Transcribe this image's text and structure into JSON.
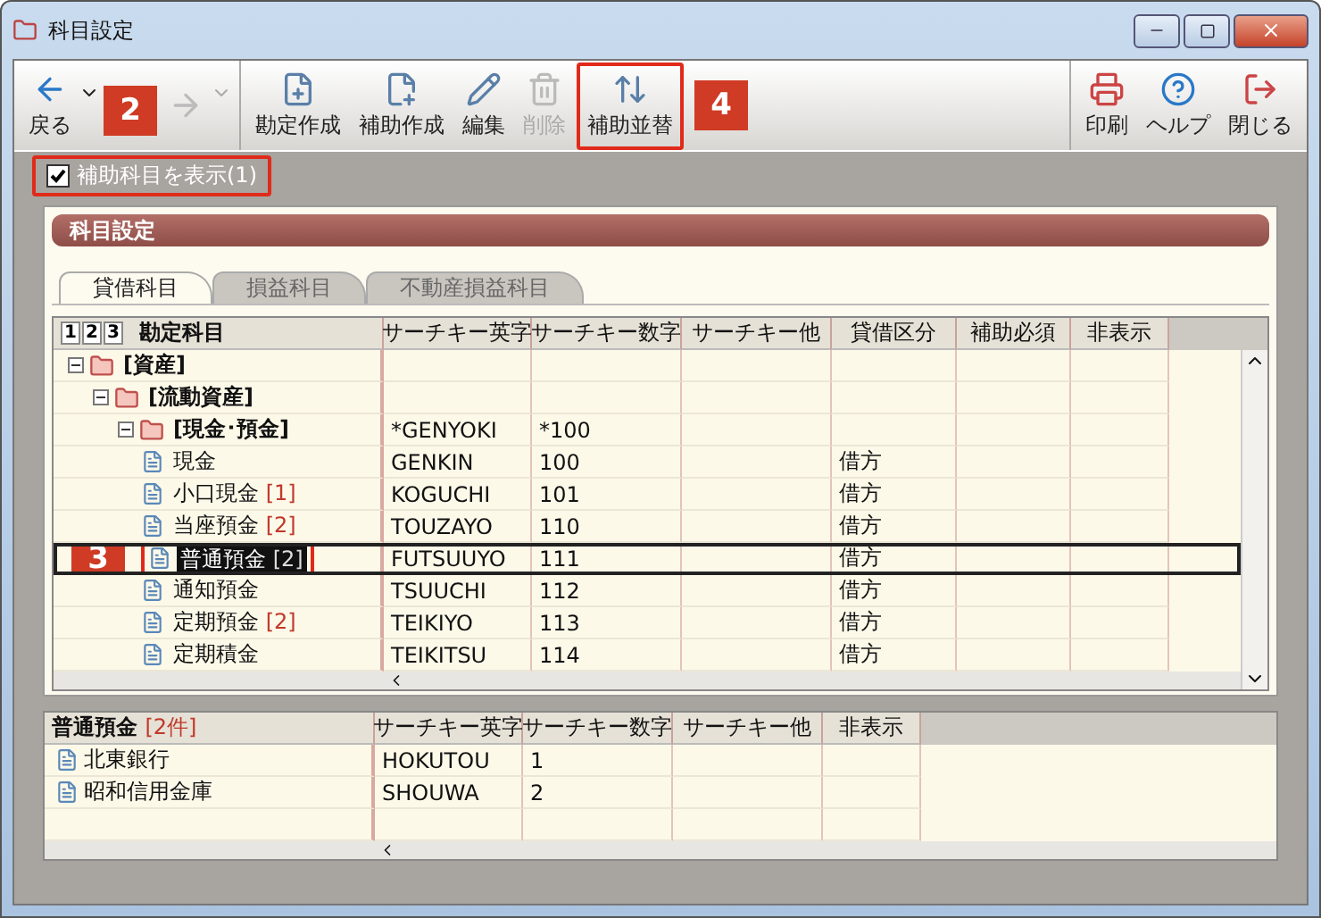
{
  "window": {
    "title": "科目設定"
  },
  "toolbar": {
    "items": [
      {
        "kind": "back",
        "label": "戻る",
        "disabled": false,
        "dropdown": true
      },
      {
        "kind": "forward",
        "disabled": true,
        "dropdown": true
      },
      {
        "kind": "new-account",
        "label": "勘定作成",
        "disabled": false
      },
      {
        "kind": "new-sub",
        "label": "補助作成",
        "disabled": false
      },
      {
        "kind": "edit",
        "label": "編集",
        "disabled": false
      },
      {
        "kind": "delete",
        "label": "削除",
        "disabled": true
      },
      {
        "kind": "sort",
        "label": "補助並替",
        "disabled": false,
        "callout": "4"
      }
    ],
    "right_items": [
      {
        "kind": "print",
        "label": "印刷",
        "disabled": false
      },
      {
        "kind": "help",
        "label": "ヘルプ",
        "disabled": false
      },
      {
        "kind": "close",
        "label": "閉じる",
        "disabled": false
      }
    ]
  },
  "show_sub_accounts": {
    "label": "補助科目を表示(1)",
    "checked": true,
    "callout": "2"
  },
  "panel": {
    "title": "科目設定"
  },
  "tabs": [
    {
      "label": "貸借科目",
      "selected": true
    },
    {
      "label": "損益科目",
      "selected": false
    },
    {
      "label": "不動産損益科目",
      "selected": false
    }
  ],
  "grid": {
    "level_buttons": [
      "1",
      "2",
      "3"
    ],
    "columns": [
      "勘定科目",
      "サーチキー英字",
      "サーチキー数字",
      "サーチキー他",
      "貸借区分",
      "補助必須",
      "非表示"
    ],
    "rows": [
      {
        "kind": "group",
        "name": "[資産]",
        "expanded": true,
        "selected": false,
        "children": [
          {
            "kind": "group",
            "name": "[流動資産]",
            "expanded": true,
            "selected": false,
            "children": [
              {
                "kind": "group",
                "name": "[現金･預金]",
                "expanded": true,
                "selected": false,
                "search_en": "*GENYOKI",
                "search_num": "*100",
                "children": [
                  {
                    "kind": "account",
                    "name": "現金",
                    "selected": false,
                    "search_en": "GENKIN",
                    "search_num": "100",
                    "dc": "借方"
                  },
                  {
                    "kind": "account",
                    "name": "小口現金",
                    "count": "[1]",
                    "selected": false,
                    "search_en": "KOGUCHI",
                    "search_num": "101",
                    "dc": "借方"
                  },
                  {
                    "kind": "account",
                    "name": "当座預金",
                    "count": "[2]",
                    "selected": false,
                    "search_en": "TOUZAYO",
                    "search_num": "110",
                    "dc": "借方"
                  },
                  {
                    "kind": "account",
                    "name": "普通預金",
                    "count": "[2]",
                    "selected": true,
                    "callout": "3",
                    "search_en": "FUTSUUYO",
                    "search_num": "111",
                    "dc": "借方"
                  },
                  {
                    "kind": "account",
                    "name": "通知預金",
                    "selected": false,
                    "search_en": "TSUUCHI",
                    "search_num": "112",
                    "dc": "借方"
                  },
                  {
                    "kind": "account",
                    "name": "定期預金",
                    "count": "[2]",
                    "selected": false,
                    "search_en": "TEIKIYO",
                    "search_num": "113",
                    "dc": "借方"
                  },
                  {
                    "kind": "account",
                    "name": "定期積金",
                    "selected": false,
                    "search_en": "TEIKITSU",
                    "search_num": "114",
                    "dc": "借方"
                  }
                ]
              }
            ]
          }
        ]
      }
    ]
  },
  "sub_grid": {
    "title": "普通預金",
    "count": "[2件]",
    "columns": [
      "サーチキー英字",
      "サーチキー数字",
      "サーチキー他",
      "非表示"
    ],
    "rows": [
      {
        "name": "北東銀行",
        "search_en": "HOKUTOU",
        "search_num": "1"
      },
      {
        "name": "昭和信用金庫",
        "search_en": "SHOUWA",
        "search_num": "2"
      }
    ]
  }
}
